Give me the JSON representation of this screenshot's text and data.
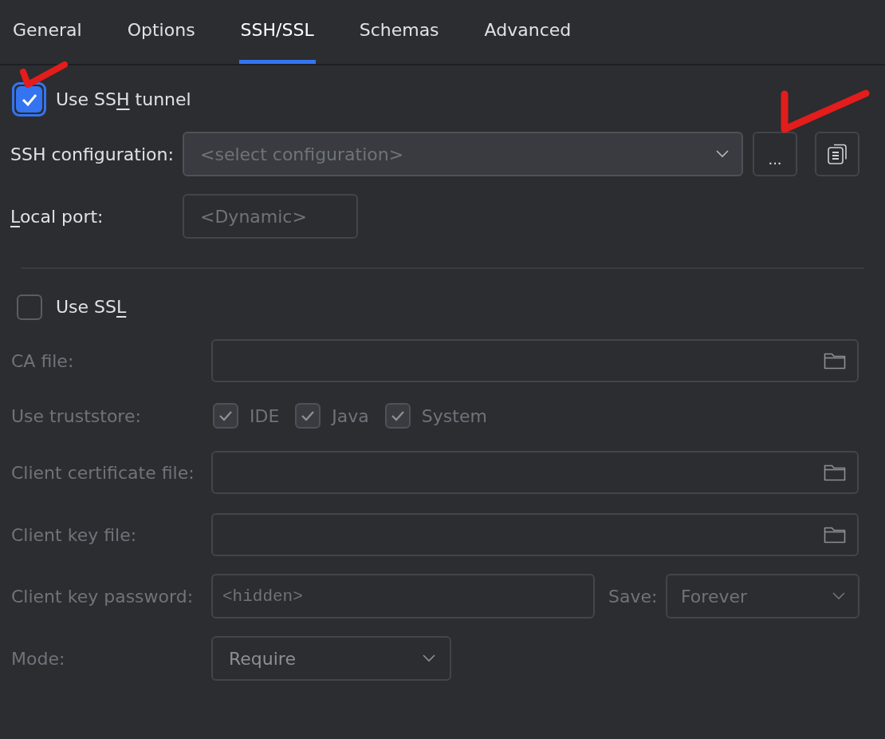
{
  "tabs": [
    {
      "label": "General",
      "selected": false
    },
    {
      "label": "Options",
      "selected": false
    },
    {
      "label": "SSH/SSL",
      "selected": true
    },
    {
      "label": "Schemas",
      "selected": false
    },
    {
      "label": "Advanced",
      "selected": false
    }
  ],
  "ssh": {
    "use_tunnel": {
      "label": [
        {
          "text": "Use SS",
          "underlined": false
        },
        {
          "text": "H",
          "underlined": true
        },
        {
          "text": " tunnel",
          "underlined": false
        }
      ],
      "checked": true
    },
    "configuration": {
      "label": "SSH configuration:",
      "placeholder": "<select configuration>"
    },
    "more_button": "...",
    "local_port": {
      "label": [
        {
          "text": "L",
          "underlined": true
        },
        {
          "text": "ocal port:",
          "underlined": false
        }
      ],
      "placeholder": "<Dynamic>"
    }
  },
  "ssl": {
    "use_ssl": {
      "label": [
        {
          "text": "Use SS",
          "underlined": false
        },
        {
          "text": "L",
          "underlined": true
        }
      ],
      "checked": false
    },
    "disabled": true,
    "ca_file": {
      "label": "CA file:"
    },
    "truststore": {
      "label": "Use truststore:",
      "options": [
        {
          "label": "IDE",
          "checked": true
        },
        {
          "label": "Java",
          "checked": true
        },
        {
          "label": "System",
          "checked": true
        }
      ]
    },
    "client_certificate_file": {
      "label": "Client certificate file:"
    },
    "client_key_file": {
      "label": "Client key file:"
    },
    "client_key_password": {
      "label": "Client key password:",
      "placeholder": "<hidden>"
    },
    "save": {
      "label": "Save:",
      "value": "Forever"
    },
    "mode": {
      "label": "Mode:",
      "value": "Require"
    }
  }
}
